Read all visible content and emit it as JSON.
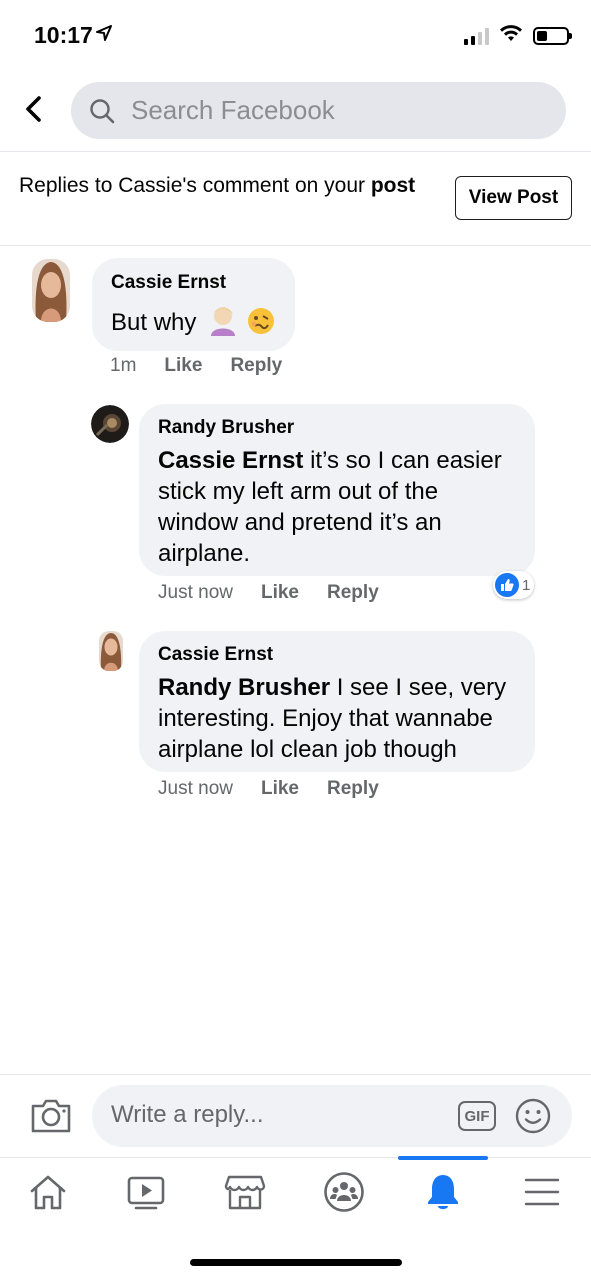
{
  "status_bar": {
    "time": "10:17"
  },
  "header": {
    "search_placeholder": "Search Facebook"
  },
  "context": {
    "text_prefix": "Replies to Cassie's comment on your ",
    "text_bold": "post",
    "view_post_label": "View Post"
  },
  "comments": [
    {
      "author": "Cassie Ernst",
      "text": "But why",
      "emojis": "🤦🏼‍♀️🥴",
      "time": "1m",
      "like": "Like",
      "reply": "Reply"
    },
    {
      "author": "Randy Brusher",
      "mention": "Cassie Ernst",
      "text": " it’s so I can easier stick my left arm out of the window and pretend it’s an airplane.",
      "time": "Just now",
      "like": "Like",
      "reply": "Reply",
      "reaction_count": "1"
    },
    {
      "author": "Cassie Ernst",
      "mention": "Randy Brusher",
      "text": " I see I see, very interesting. Enjoy that wannabe airplane lol clean job though",
      "time": "Just now",
      "like": "Like",
      "reply": "Reply"
    }
  ],
  "composer": {
    "placeholder": "Write a reply...",
    "gif_label": "GIF"
  },
  "tabs": [
    {
      "icon": "home-icon"
    },
    {
      "icon": "watch-icon"
    },
    {
      "icon": "marketplace-icon"
    },
    {
      "icon": "groups-icon"
    },
    {
      "icon": "notifications-icon",
      "active": true
    },
    {
      "icon": "menu-icon"
    }
  ],
  "colors": {
    "accent": "#1877f2",
    "bubble": "#f0f2f5",
    "secondary_text": "#65676b"
  }
}
